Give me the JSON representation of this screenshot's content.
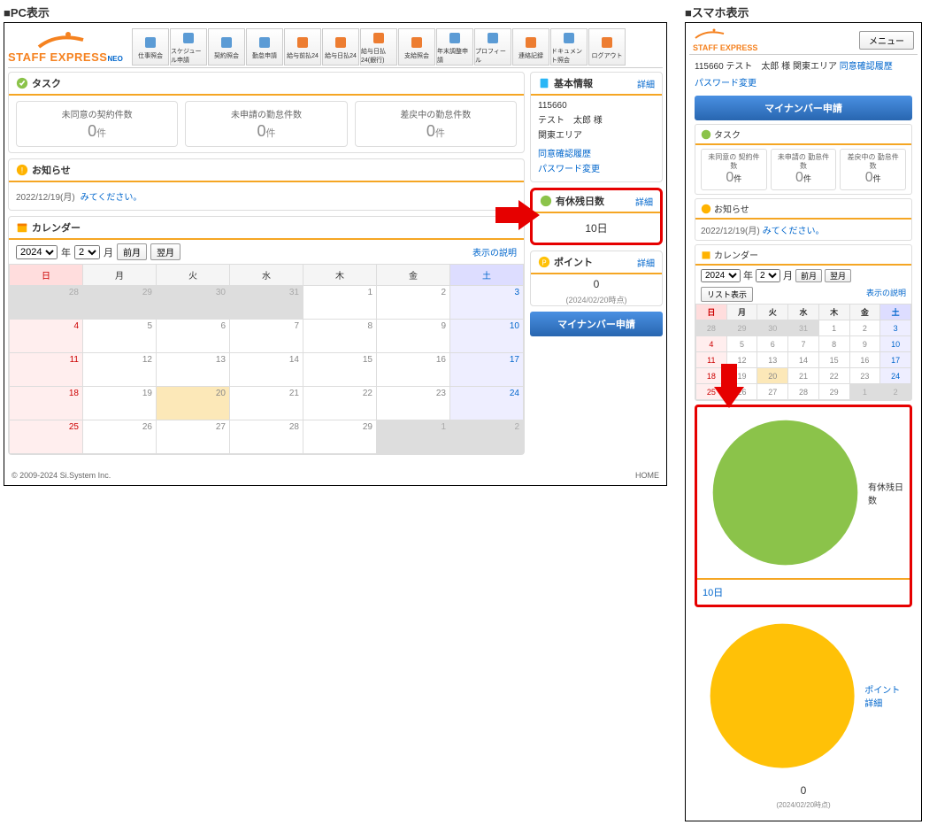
{
  "labels": {
    "pc": "■PC表示",
    "sp": "■スマホ表示"
  },
  "logo": {
    "text": "STAFF EXPRESS",
    "neo": "NEO"
  },
  "toolbar": [
    {
      "name": "shigoto",
      "label": "仕事照会"
    },
    {
      "name": "schedule",
      "label": "スケジュール申請"
    },
    {
      "name": "keiyaku",
      "label": "契約照会"
    },
    {
      "name": "kintai",
      "label": "勤怠申請"
    },
    {
      "name": "kyuyo-m24",
      "label": "給与前払24"
    },
    {
      "name": "kyuyo-h24",
      "label": "給与日払24"
    },
    {
      "name": "kyuyo-h24g",
      "label": "給与日払24(銀行)"
    },
    {
      "name": "shikyuu",
      "label": "支給照会"
    },
    {
      "name": "nencho",
      "label": "年末調整申請"
    },
    {
      "name": "profile",
      "label": "プロフィール"
    },
    {
      "name": "renraku",
      "label": "連絡記録"
    },
    {
      "name": "document",
      "label": "ドキュメント照会"
    },
    {
      "name": "logout",
      "label": "ログアウト"
    }
  ],
  "task": {
    "title": "タスク",
    "items": [
      {
        "label": "未同意の契約件数",
        "count": "0",
        "unit": "件"
      },
      {
        "label": "未申請の勤怠件数",
        "count": "0",
        "unit": "件"
      },
      {
        "label": "差戻中の勤怠件数",
        "count": "0",
        "unit": "件"
      }
    ]
  },
  "news": {
    "title": "お知らせ",
    "items": [
      {
        "date": "2022/12/19(月)",
        "text": "みてください。"
      }
    ]
  },
  "calendar": {
    "title": "カレンダー",
    "year": "2024",
    "month": "2",
    "year_unit": "年",
    "month_unit": "月",
    "prev": "前月",
    "next": "翌月",
    "legend": "表示の説明",
    "list": "リスト表示",
    "dow": [
      "日",
      "月",
      "火",
      "水",
      "木",
      "金",
      "土"
    ]
  },
  "basic": {
    "title": "基本情報",
    "detail": "詳細",
    "id": "115660",
    "name": "テスト　太郎 様",
    "area": "関東エリア",
    "agree_link": "同意確認履歴",
    "pass_link": "パスワード変更"
  },
  "yukyu": {
    "title": "有休残日数",
    "detail": "詳細",
    "value": "10日"
  },
  "point": {
    "title": "ポイント",
    "detail": "詳細",
    "point_detail": "ポイント詳細",
    "value": "0",
    "asof": "(2024/02/20時点)"
  },
  "mynumber": {
    "label": "マイナンバー申請"
  },
  "footer": {
    "copy": "© 2009-2024 Si.System Inc.",
    "home": "HOME"
  },
  "sp": {
    "menu": "メニュー",
    "user": "115660 テスト　太郎 様 関東エリア",
    "agree": "同意確認履歴",
    "task_labels": [
      "未同意の\n契約件数",
      "未申請の\n勤怠件数",
      "差戻中の\n勤怠件数"
    ]
  }
}
